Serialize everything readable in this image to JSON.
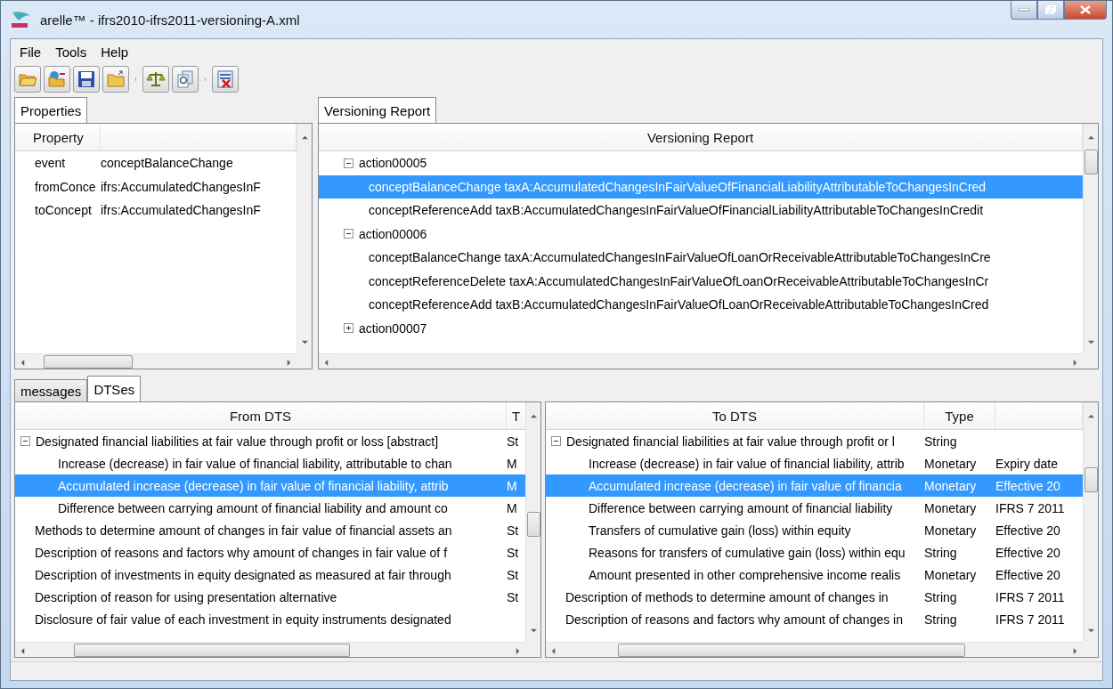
{
  "window": {
    "title": "arelle™ - ifrs2010-ifrs2011-versioning-A.xml"
  },
  "menu": [
    "File",
    "Tools",
    "Help"
  ],
  "properties": {
    "tab": "Properties",
    "columns": [
      "Property"
    ],
    "rows": [
      {
        "name": "event",
        "value": "conceptBalanceChange"
      },
      {
        "name": "fromConce",
        "value": "ifrs:AccumulatedChangesInF"
      },
      {
        "name": "toConcept",
        "value": "ifrs:AccumulatedChangesInF"
      }
    ]
  },
  "versioning_report": {
    "tab": "Versioning Report",
    "column": "Versioning Report",
    "tree": [
      {
        "label": "action00005",
        "expanded": true,
        "selected": false,
        "children": [
          {
            "label": "conceptBalanceChange taxA:AccumulatedChangesInFairValueOfFinancialLiabilityAttributableToChangesInCred",
            "selected": true
          },
          {
            "label": "conceptReferenceAdd taxB:AccumulatedChangesInFairValueOfFinancialLiabilityAttributableToChangesInCredit",
            "selected": false
          }
        ]
      },
      {
        "label": "action00006",
        "expanded": true,
        "selected": false,
        "children": [
          {
            "label": "conceptBalanceChange taxA:AccumulatedChangesInFairValueOfLoanOrReceivableAttributableToChangesInCre",
            "selected": false
          },
          {
            "label": "conceptReferenceDelete taxA:AccumulatedChangesInFairValueOfLoanOrReceivableAttributableToChangesInCr",
            "selected": false
          },
          {
            "label": "conceptReferenceAdd taxB:AccumulatedChangesInFairValueOfLoanOrReceivableAttributableToChangesInCred",
            "selected": false
          }
        ]
      },
      {
        "label": "action00007",
        "expanded": false,
        "selected": false
      }
    ]
  },
  "bottom_tabs": [
    {
      "label": "messages",
      "selected": false
    },
    {
      "label": "DTSes",
      "selected": true
    }
  ],
  "from_dts": {
    "columns": [
      "From DTS",
      "T"
    ],
    "rows": [
      {
        "cells": [
          "Designated financial liabilities at fair value through profit or loss [abstract]",
          "St"
        ],
        "expanded": true,
        "selected": false,
        "children": [
          {
            "cells": [
              "Increase (decrease) in fair value of financial liability, attributable to chan",
              "M"
            ],
            "selected": false
          },
          {
            "cells": [
              "Accumulated increase (decrease) in fair value of financial liability, attrib",
              "M"
            ],
            "selected": true
          },
          {
            "cells": [
              "Difference between carrying amount of financial liability and amount co",
              "M"
            ],
            "selected": false
          }
        ]
      },
      {
        "cells": [
          "Methods to determine amount of changes in fair value of financial assets an",
          "St"
        ],
        "selected": false
      },
      {
        "cells": [
          "Description of reasons and factors why amount of changes in fair value of f",
          "St"
        ],
        "selected": false
      },
      {
        "cells": [
          "Description of investments in equity designated as measured at fair through",
          "St"
        ],
        "selected": false
      },
      {
        "cells": [
          "Description of reason for using presentation alternative",
          "St"
        ],
        "selected": false
      },
      {
        "cells": [
          "Disclosure of fair value of each investment in equity instruments designated"
        ],
        "selected": false
      }
    ]
  },
  "to_dts": {
    "columns": [
      "To DTS",
      "Type"
    ],
    "rows": [
      {
        "cells": [
          "Designated financial liabilities at fair value through profit or l",
          "String"
        ],
        "expanded": true,
        "selected": false,
        "children": [
          {
            "cells": [
              "Increase (decrease) in fair value of financial liability, attrib",
              "Monetary",
              "Expiry date"
            ],
            "selected": false
          },
          {
            "cells": [
              "Accumulated increase (decrease) in fair value of financia",
              "Monetary",
              "Effective 20"
            ],
            "selected": true
          },
          {
            "cells": [
              "Difference between carrying amount of financial liability",
              "Monetary",
              "IFRS 7 2011"
            ],
            "selected": false
          },
          {
            "cells": [
              "Transfers of cumulative gain (loss) within equity",
              "Monetary",
              "Effective 20"
            ],
            "selected": false
          },
          {
            "cells": [
              "Reasons for transfers of cumulative gain (loss) within equ",
              "String",
              "Effective 20"
            ],
            "selected": false
          },
          {
            "cells": [
              "Amount presented in other comprehensive income realis",
              "Monetary",
              "Effective 20"
            ],
            "selected": false
          }
        ]
      },
      {
        "cells": [
          "Description of methods to determine amount of changes in",
          "String",
          "IFRS 7 2011"
        ],
        "selected": false
      },
      {
        "cells": [
          "Description of reasons and factors why amount of changes in",
          "String",
          "IFRS 7 2011"
        ],
        "selected": false
      }
    ]
  }
}
